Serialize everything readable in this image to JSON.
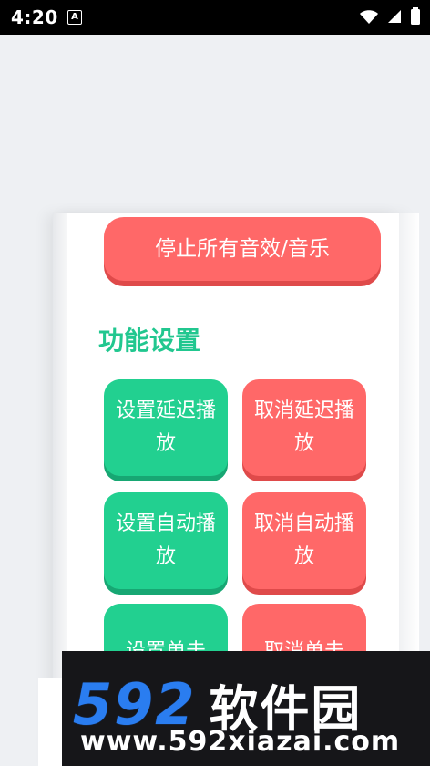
{
  "status_bar": {
    "time": "4:20",
    "notification_label": "A",
    "icons": [
      "wifi-icon",
      "signal-icon",
      "battery-icon"
    ]
  },
  "actions": {
    "stop_all": "停止所有音效/音乐"
  },
  "section": {
    "title": "功能设置"
  },
  "buttons": [
    {
      "label": "设置延迟播放",
      "color": "#22d090"
    },
    {
      "label": "取消延迟播放",
      "color": "#ff6868"
    },
    {
      "label": "设置自动播放",
      "color": "#22d090"
    },
    {
      "label": "取消自动播放",
      "color": "#ff6868"
    },
    {
      "label": "设置单击",
      "color": "#22d090"
    },
    {
      "label": "取消单击",
      "color": "#ff6868"
    }
  ],
  "watermark": {
    "number": "592",
    "brand": "软件园",
    "url": "www.592xiazai.com"
  },
  "colors": {
    "green": "#22d090",
    "red": "#ff6868",
    "title_green": "#21c78f"
  }
}
